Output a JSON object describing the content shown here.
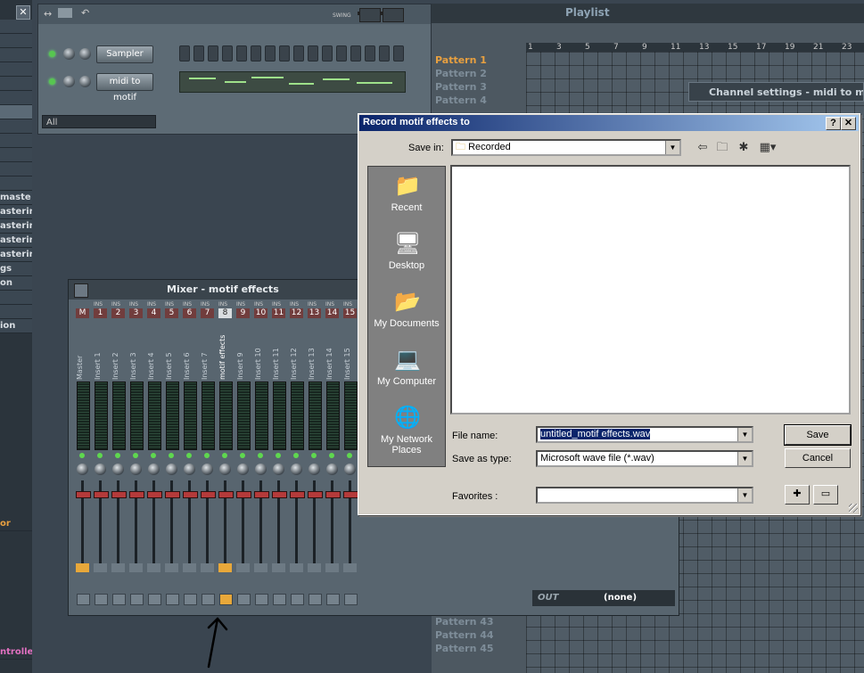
{
  "left_browser": {
    "items": [
      {
        "label": ""
      },
      {
        "label": ""
      },
      {
        "label": ""
      },
      {
        "label": ""
      },
      {
        "label": ""
      },
      {
        "label": ""
      },
      {
        "label": ""
      },
      {
        "label": ""
      },
      {
        "label": ""
      },
      {
        "label": ""
      },
      {
        "label": ""
      },
      {
        "label": ""
      },
      {
        "label": "maste"
      },
      {
        "label": "asterin"
      },
      {
        "label": "asterin"
      },
      {
        "label": "asterin"
      },
      {
        "label": "asterin"
      },
      {
        "label": "gs"
      },
      {
        "label": "on"
      },
      {
        "label": ""
      },
      {
        "label": ""
      },
      {
        "label": "ion"
      }
    ],
    "bottom_items": [
      {
        "label": "or",
        "color": "orange"
      },
      {
        "label": "ntrolle",
        "color": "pink"
      }
    ]
  },
  "step_sequencer": {
    "channels": [
      {
        "name": "Sampler",
        "steps": 16
      },
      {
        "name": "midi to motif"
      }
    ],
    "filter": "All",
    "swing_label": "SWING"
  },
  "playlist": {
    "title": "Playlist",
    "ruler": [
      "1",
      "3",
      "5",
      "7",
      "9",
      "11",
      "13",
      "15",
      "17",
      "19",
      "21",
      "23"
    ],
    "patterns_top": [
      "Pattern 1",
      "Pattern 2",
      "Pattern 3",
      "Pattern 4"
    ],
    "patterns_bottom": [
      "Pattern 43",
      "Pattern 44",
      "Pattern 45"
    ],
    "channel_settings_title": "Channel settings - midi to motif"
  },
  "mixer": {
    "title": "Mixer - motif effects",
    "ins_label": "INS",
    "tracks": [
      {
        "num": "M",
        "name": "Master"
      },
      {
        "num": "1",
        "name": "Insert 1"
      },
      {
        "num": "2",
        "name": "Insert 2"
      },
      {
        "num": "3",
        "name": "Insert 3"
      },
      {
        "num": "4",
        "name": "Insert 4"
      },
      {
        "num": "5",
        "name": "Insert 5"
      },
      {
        "num": "6",
        "name": "Insert 6"
      },
      {
        "num": "7",
        "name": "Insert 7"
      },
      {
        "num": "8",
        "name": "motif effects",
        "selected": true
      },
      {
        "num": "9",
        "name": "Insert 9"
      },
      {
        "num": "10",
        "name": "Insert 10"
      },
      {
        "num": "11",
        "name": "Insert 11"
      },
      {
        "num": "12",
        "name": "Insert 12"
      },
      {
        "num": "13",
        "name": "Insert 13"
      },
      {
        "num": "14",
        "name": "Insert 14"
      },
      {
        "num": "15",
        "name": "Insert 15"
      }
    ],
    "output": "(none)",
    "out_label": "OUT"
  },
  "dialog": {
    "title": "Record motif effects to",
    "help_btn": "?",
    "close_btn": "✕",
    "save_in_label": "Save in:",
    "save_in_value": "Recorded",
    "places": [
      {
        "label": "Recent",
        "icon": "recent-folder-icon",
        "glyph": "📁"
      },
      {
        "label": "Desktop",
        "icon": "desktop-icon",
        "glyph": "🖥"
      },
      {
        "label": "My Documents",
        "icon": "documents-icon",
        "glyph": "📂"
      },
      {
        "label": "My Computer",
        "icon": "computer-icon",
        "glyph": "💻"
      },
      {
        "label": "My Network Places",
        "icon": "network-icon",
        "glyph": "🌐"
      }
    ],
    "file_name_label": "File name:",
    "file_name_value": "untitled_motif effects.wav",
    "save_as_type_label": "Save as type:",
    "save_as_type_value": "Microsoft wave file (*.wav)",
    "favorites_label": "Favorites :",
    "favorites_value": "",
    "save_btn": "Save",
    "cancel_btn": "Cancel"
  }
}
